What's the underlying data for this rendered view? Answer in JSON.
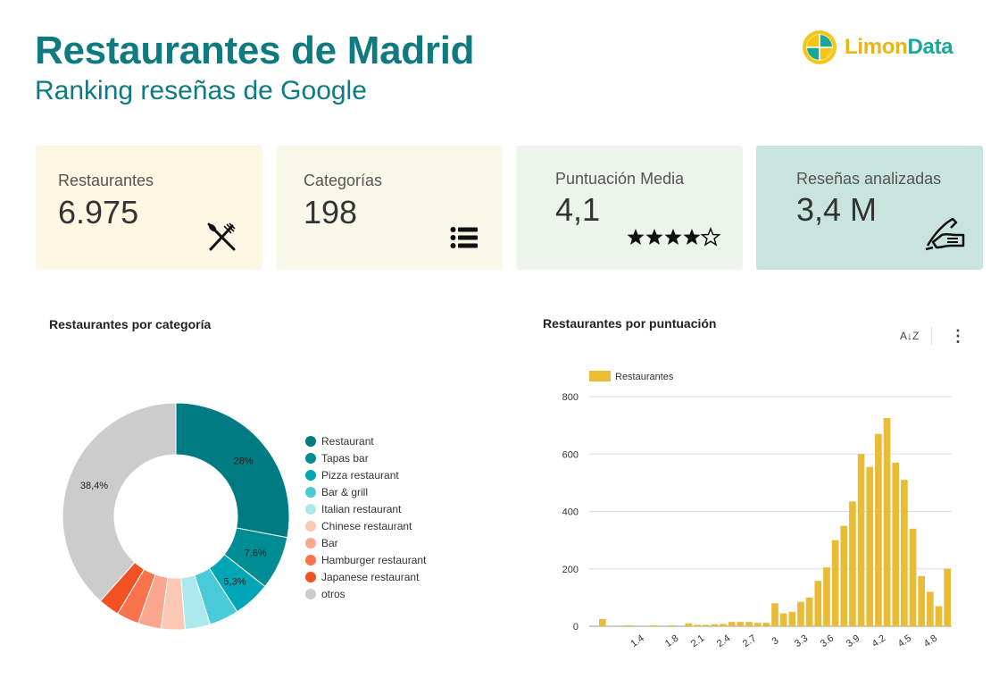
{
  "header": {
    "title": "Restaurantes de Madrid",
    "subtitle": "Ranking reseñas de Google",
    "logo_text_a": "Limon",
    "logo_text_b": "Data"
  },
  "kpis": [
    {
      "label": "Restaurantes",
      "value": "6.975",
      "icon": "fork-knife-icon",
      "bg": "#fef7e4"
    },
    {
      "label": "Categorías",
      "value": "198",
      "icon": "list-icon",
      "bg": "#f9f9ea"
    },
    {
      "label": "Puntuación Media",
      "value": "4,1",
      "icon": "stars-icon",
      "bg": "#ecf4ec"
    },
    {
      "label": "Reseñas analizadas",
      "value": "3,4 M",
      "icon": "writing-hand-icon",
      "bg": "#c9e3dd"
    }
  ],
  "colors": {
    "accent": "#0f7a80",
    "bar": "#e8bc35",
    "grid": "#dddddd"
  },
  "toolbar": {
    "sort_icon": "sort-az-icon",
    "more_icon": "more-vert-icon"
  },
  "chart_data": [
    {
      "type": "pie",
      "title": "Restaurantes por categoría",
      "donut": true,
      "slices": [
        {
          "label": "Restaurant",
          "value": 28,
          "display": "28%",
          "color": "#007b83"
        },
        {
          "label": "Tapas bar",
          "value": 7.6,
          "display": "7,6%",
          "color": "#008c93"
        },
        {
          "label": "Pizza restaurant",
          "value": 5.3,
          "display": "5,3%",
          "color": "#00a6b4"
        },
        {
          "label": "Bar & grill",
          "value": 4.2,
          "display": "",
          "color": "#48cad8"
        },
        {
          "label": "Italian restaurant",
          "value": 3.6,
          "display": "",
          "color": "#ace9ef"
        },
        {
          "label": "Chinese restaurant",
          "value": 3.4,
          "display": "",
          "color": "#fcc8b4"
        },
        {
          "label": "Bar",
          "value": 3.3,
          "display": "",
          "color": "#fba68f"
        },
        {
          "label": "Hamburger restaurant",
          "value": 3.2,
          "display": "",
          "color": "#f9734d"
        },
        {
          "label": "Japanese restaurant",
          "value": 3.0,
          "display": "",
          "color": "#f25223"
        },
        {
          "label": "otros",
          "value": 38.4,
          "display": "38,4%",
          "color": "#cccccc"
        }
      ],
      "legend_position": "right"
    },
    {
      "type": "bar",
      "title": "Restaurantes por puntuación",
      "legend": [
        "Restaurantes"
      ],
      "legend_position": "top-left",
      "ylim": [
        0,
        800
      ],
      "yticks": [
        0,
        200,
        400,
        600,
        800
      ],
      "xtick_labels": [
        "1.4",
        "1.8",
        "2.1",
        "2.4",
        "2.7",
        "3",
        "3.3",
        "3.6",
        "3.9",
        "4.2",
        "4.5",
        "4.8"
      ],
      "categories": [
        1.0,
        1.1,
        1.2,
        1.3,
        1.4,
        1.5,
        1.6,
        1.7,
        1.8,
        1.9,
        2.0,
        2.1,
        2.2,
        2.3,
        2.4,
        2.5,
        2.6,
        2.7,
        2.8,
        2.9,
        3.0,
        3.1,
        3.2,
        3.3,
        3.4,
        3.5,
        3.6,
        3.7,
        3.8,
        3.9,
        4.0,
        4.1,
        4.2,
        4.3,
        4.4,
        4.5,
        4.6,
        4.7,
        4.8,
        4.9,
        5.0
      ],
      "series": [
        {
          "name": "Restaurantes",
          "values": [
            25,
            0,
            0,
            3,
            0,
            0,
            3,
            0,
            3,
            0,
            10,
            5,
            5,
            7,
            8,
            15,
            15,
            15,
            12,
            12,
            80,
            45,
            50,
            85,
            100,
            158,
            205,
            300,
            350,
            435,
            600,
            555,
            670,
            725,
            570,
            510,
            340,
            175,
            120,
            70,
            200
          ]
        }
      ],
      "grid": true
    }
  ]
}
